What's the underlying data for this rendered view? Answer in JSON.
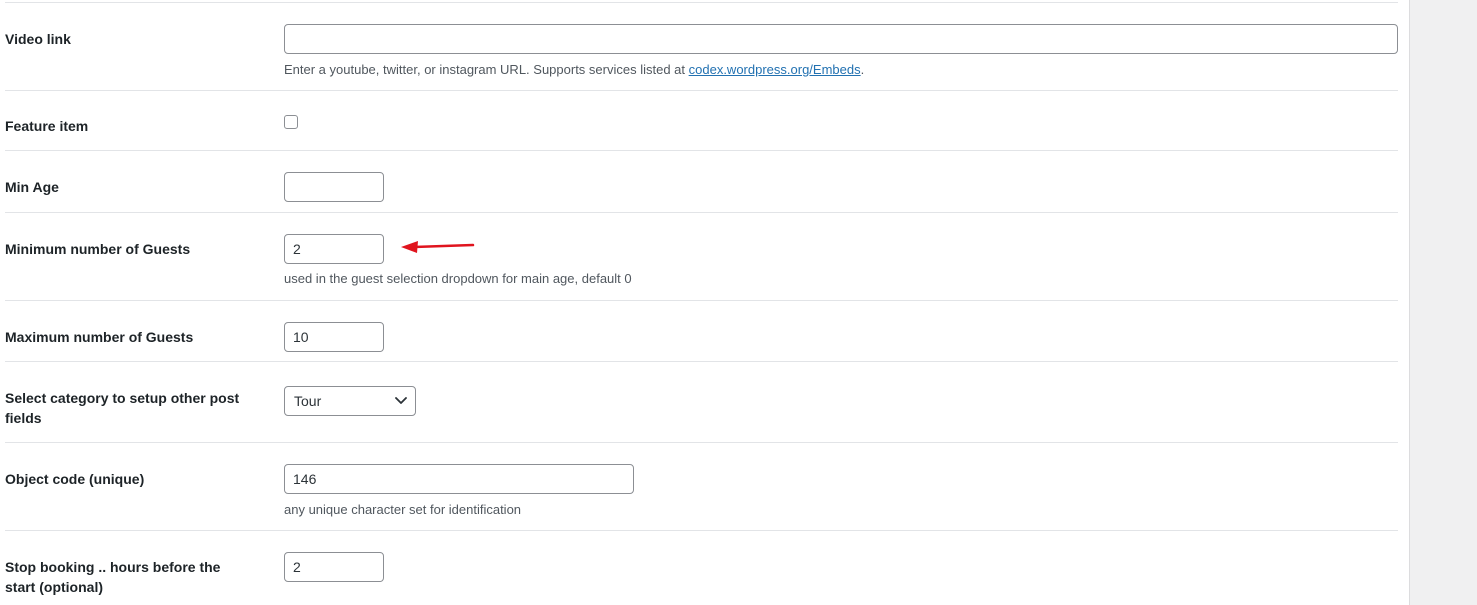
{
  "fields": {
    "video_link": {
      "label": "Video link",
      "value": "",
      "description_prefix": "Enter a youtube, twitter, or instagram URL. Supports services listed at ",
      "description_link": "codex.wordpress.org/Embeds",
      "description_suffix": "."
    },
    "feature_item": {
      "label": "Feature item",
      "checked": false
    },
    "min_age": {
      "label": "Min Age",
      "value": ""
    },
    "min_guests": {
      "label": "Minimum number of Guests",
      "value": "2",
      "description": "used in the guest selection dropdown for main age, default 0"
    },
    "max_guests": {
      "label": "Maximum number of Guests",
      "value": "10"
    },
    "category": {
      "label_line1": "Select category to setup other post",
      "label_line2": "fields",
      "selected": "Tour"
    },
    "object_code": {
      "label": "Object code (unique)",
      "value": "146",
      "description": "any unique character set for identification"
    },
    "stop_booking": {
      "label_line1": "Stop booking .. hours before the",
      "label_line2": "start (optional)",
      "value": "2"
    }
  },
  "annotation": {
    "arrow_color": "#e0141e",
    "icon": "red-arrow-left-icon"
  },
  "colors": {
    "link": "#2271b1",
    "border": "#8c8f94",
    "sidebar_bg": "#f0f0f1"
  }
}
